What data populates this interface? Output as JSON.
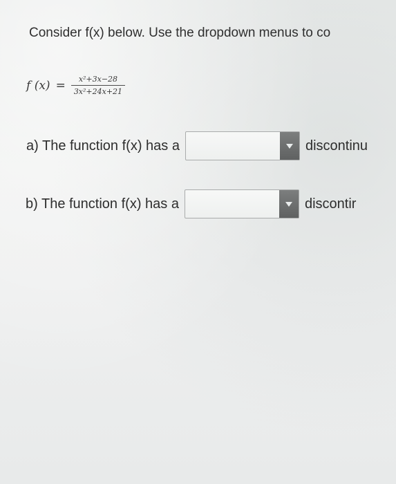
{
  "prompt": {
    "text": "Consider f(x) below. Use the dropdown menus to co"
  },
  "formula": {
    "lhs": "f (x)",
    "equals": "=",
    "numerator": "x²+3x−28",
    "denominator": "3x²+24x+21"
  },
  "part_a": {
    "label": "a) The function f(x) has a",
    "selected_value": "",
    "trailing_text": "discontinu"
  },
  "part_b": {
    "label": "b) The function f(x) has a",
    "selected_value": "",
    "trailing_text": "discontir"
  },
  "icons": {
    "dropdown": "chevron-down-icon"
  }
}
